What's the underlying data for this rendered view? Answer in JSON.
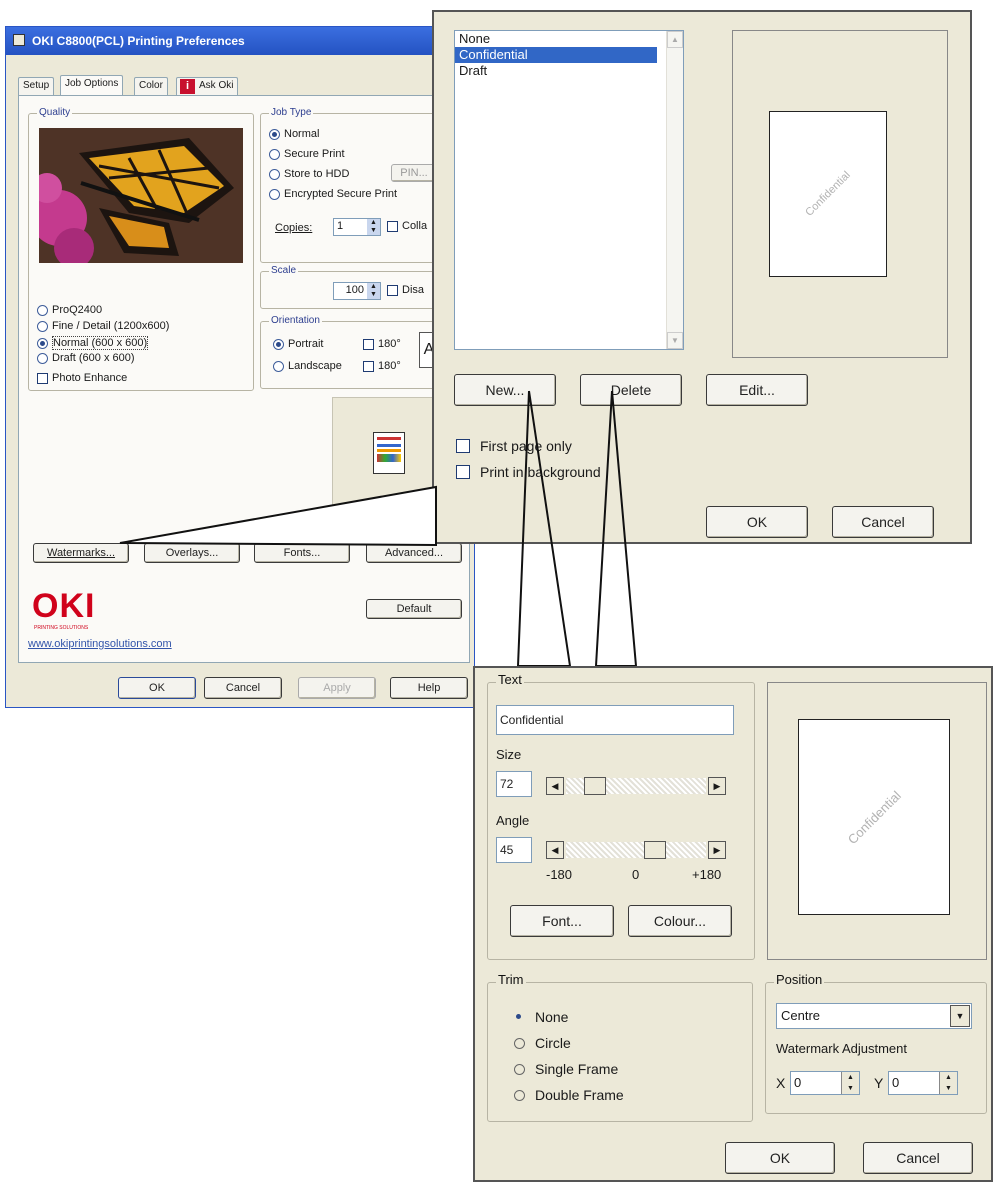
{
  "main_dialog": {
    "title": "OKI C8800(PCL) Printing Preferences",
    "tabs": [
      "Setup",
      "Job Options",
      "Color",
      "Ask Oki"
    ],
    "quality": {
      "label": "Quality",
      "options": [
        "ProQ2400",
        "Fine / Detail (1200x600)",
        "Normal (600 x 600)",
        "Draft (600 x 600)"
      ],
      "selected": "Normal (600 x 600)",
      "photo_enhance": "Photo Enhance"
    },
    "job_type": {
      "label": "Job Type",
      "options": [
        "Normal",
        "Secure Print",
        "Store to HDD",
        "Encrypted Secure Print"
      ],
      "selected": "Normal",
      "pin_button": "PIN...",
      "copies_label": "Copies:",
      "copies_value": "1",
      "collate_label": "Colla"
    },
    "scale": {
      "label": "Scale",
      "value": "100",
      "disable_label": "Disa"
    },
    "orientation": {
      "label": "Orientation",
      "options": [
        "Portrait",
        "Landscape"
      ],
      "selected": "Portrait",
      "rotate_1": "180°",
      "rotate_2": "180°",
      "preview_letter": "A"
    },
    "buttons": {
      "watermarks": "Watermarks...",
      "overlays": "Overlays...",
      "fonts": "Fonts...",
      "advanced": "Advanced...",
      "default": "Default",
      "ok": "OK",
      "cancel": "Cancel",
      "apply": "Apply",
      "help": "Help"
    },
    "brand": {
      "logo": "OKI",
      "tagline": "PRINTING SOLUTIONS",
      "url": "www.okiprintingsolutions.com"
    }
  },
  "watermark_dialog": {
    "list": [
      "None",
      "Confidential",
      "Draft"
    ],
    "selected": "Confidential",
    "preview_text": "Confidential",
    "buttons": {
      "new": "New...",
      "delete": "Delete",
      "edit": "Edit...",
      "ok": "OK",
      "cancel": "Cancel"
    },
    "first_page_only": "First page only",
    "print_in_background": "Print in background"
  },
  "edit_dialog": {
    "text_group": "Text",
    "text_value": "Confidential",
    "size_label": "Size",
    "size_value": "72",
    "angle_label": "Angle",
    "angle_value": "45",
    "angle_ticks": [
      "-180",
      "0",
      "+180"
    ],
    "font_button": "Font...",
    "colour_button": "Colour...",
    "preview_text": "Confidential",
    "trim": {
      "label": "Trim",
      "options": [
        "None",
        "Circle",
        "Single Frame",
        "Double Frame"
      ],
      "selected": "None"
    },
    "position": {
      "label": "Position",
      "value": "Centre",
      "adjust_label": "Watermark Adjustment",
      "x_label": "X",
      "x_value": "0",
      "y_label": "Y",
      "y_value": "0"
    },
    "buttons": {
      "ok": "OK",
      "cancel": "Cancel"
    }
  }
}
